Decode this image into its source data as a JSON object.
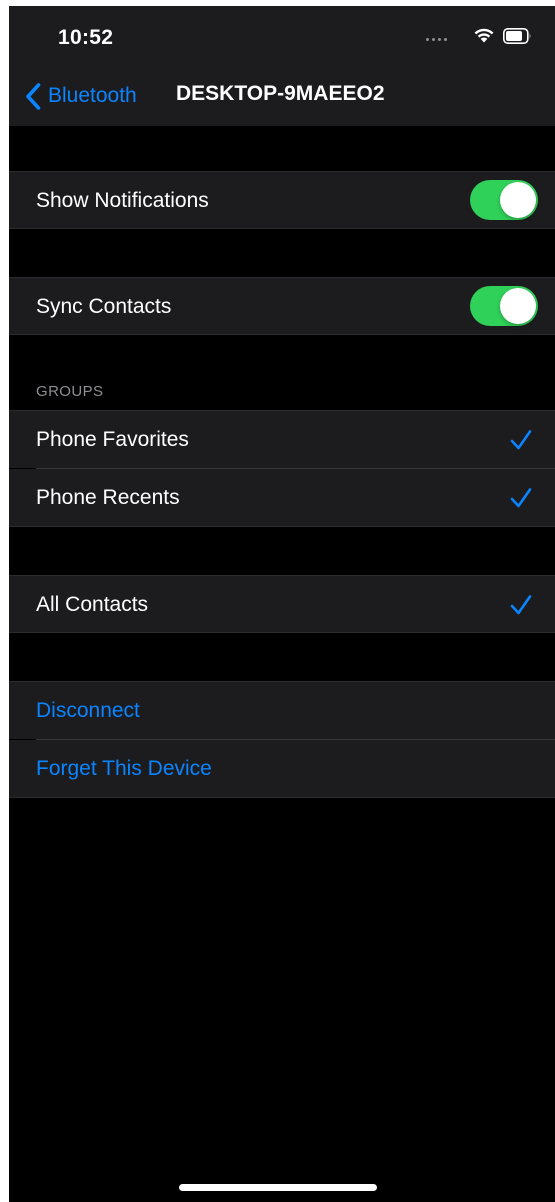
{
  "status_bar": {
    "time": "10:52",
    "icons": [
      "signal-dots-icon",
      "wifi-icon",
      "battery-icon"
    ]
  },
  "nav": {
    "back_label": "Bluetooth",
    "title": "DESKTOP-9MAEEO2"
  },
  "settings": {
    "show_notifications": {
      "label": "Show Notifications",
      "enabled": true
    },
    "sync_contacts": {
      "label": "Sync Contacts",
      "enabled": true
    }
  },
  "groups": {
    "header": "GROUPS",
    "items": [
      {
        "label": "Phone Favorites",
        "checked": true
      },
      {
        "label": "Phone Recents",
        "checked": true
      }
    ]
  },
  "all_contacts": {
    "label": "All Contacts",
    "checked": true
  },
  "actions": {
    "disconnect_label": "Disconnect",
    "forget_label": "Forget This Device"
  },
  "colors": {
    "accent": "#0a84ff",
    "toggle_on": "#30d158",
    "cell_background": "#1c1c1e",
    "screen_background": "#000000"
  }
}
